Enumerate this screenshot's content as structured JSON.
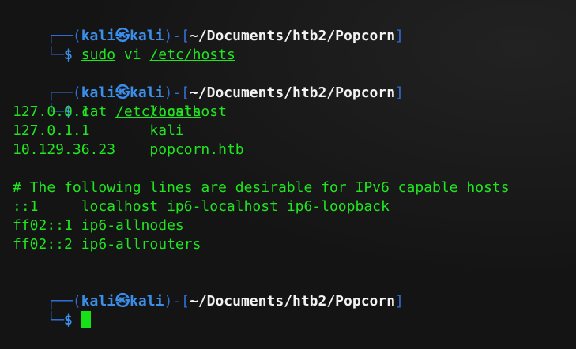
{
  "prompt": {
    "top_left": "┌──(",
    "user": "kali",
    "skull": "㉿",
    "host": "kali",
    "close_open": ")-[",
    "path": "~/Documents/htb2/Popcorn",
    "close": "]",
    "bottom_left": "└─",
    "dollar": "$"
  },
  "commands": [
    {
      "cmd": "sudo",
      "sep": " vi ",
      "arg": "/etc/hosts"
    },
    {
      "cmd": "cat",
      "sep": " ",
      "arg": "/etc/hosts"
    }
  ],
  "hosts_output": [
    "127.0.0.1       localhost",
    "127.0.1.1       kali",
    "10.129.36.23    popcorn.htb",
    "",
    "# The following lines are desirable for IPv6 capable hosts",
    "::1     localhost ip6-localhost ip6-loopback",
    "ff02::1 ip6-allnodes",
    "ff02::2 ip6-allrouters"
  ]
}
